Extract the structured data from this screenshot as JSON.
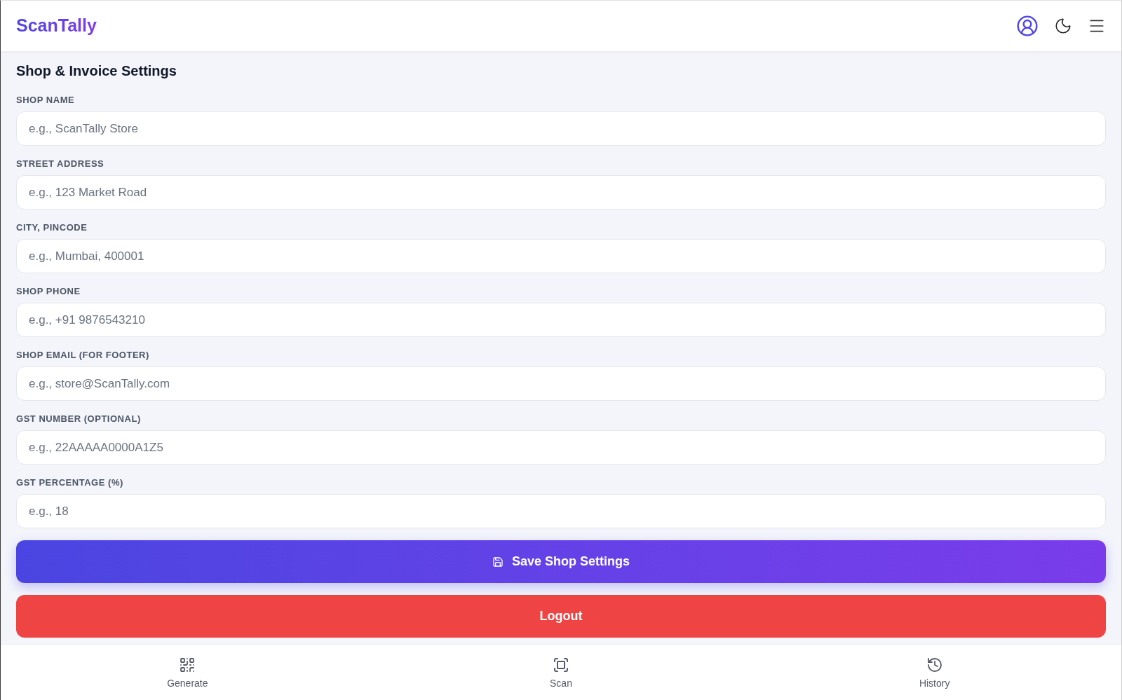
{
  "header": {
    "logo": "ScanTally"
  },
  "settings": {
    "title": "Shop & Invoice Settings",
    "fields": [
      {
        "label": "SHOP NAME",
        "placeholder": "e.g., ScanTally Store"
      },
      {
        "label": "STREET ADDRESS",
        "placeholder": "e.g., 123 Market Road"
      },
      {
        "label": "CITY, PINCODE",
        "placeholder": "e.g., Mumbai, 400001"
      },
      {
        "label": "SHOP PHONE",
        "placeholder": "e.g., +91 9876543210"
      },
      {
        "label": "SHOP EMAIL (FOR FOOTER)",
        "placeholder": "e.g., store@ScanTally.com"
      },
      {
        "label": "GST NUMBER (OPTIONAL)",
        "placeholder": "e.g., 22AAAAA0000A1Z5"
      },
      {
        "label": "GST PERCENTAGE (%)",
        "placeholder": "e.g., 18"
      }
    ]
  },
  "buttons": [
    {
      "kind": "save",
      "label": "Save Shop Settings"
    },
    {
      "kind": "logout",
      "label": "Logout"
    }
  ],
  "bottom_nav": [
    {
      "kind": "generate",
      "label": "Generate",
      "selected": false
    },
    {
      "kind": "scan",
      "label": "Scan",
      "selected": false
    },
    {
      "kind": "history",
      "label": "History",
      "selected": false
    }
  ]
}
